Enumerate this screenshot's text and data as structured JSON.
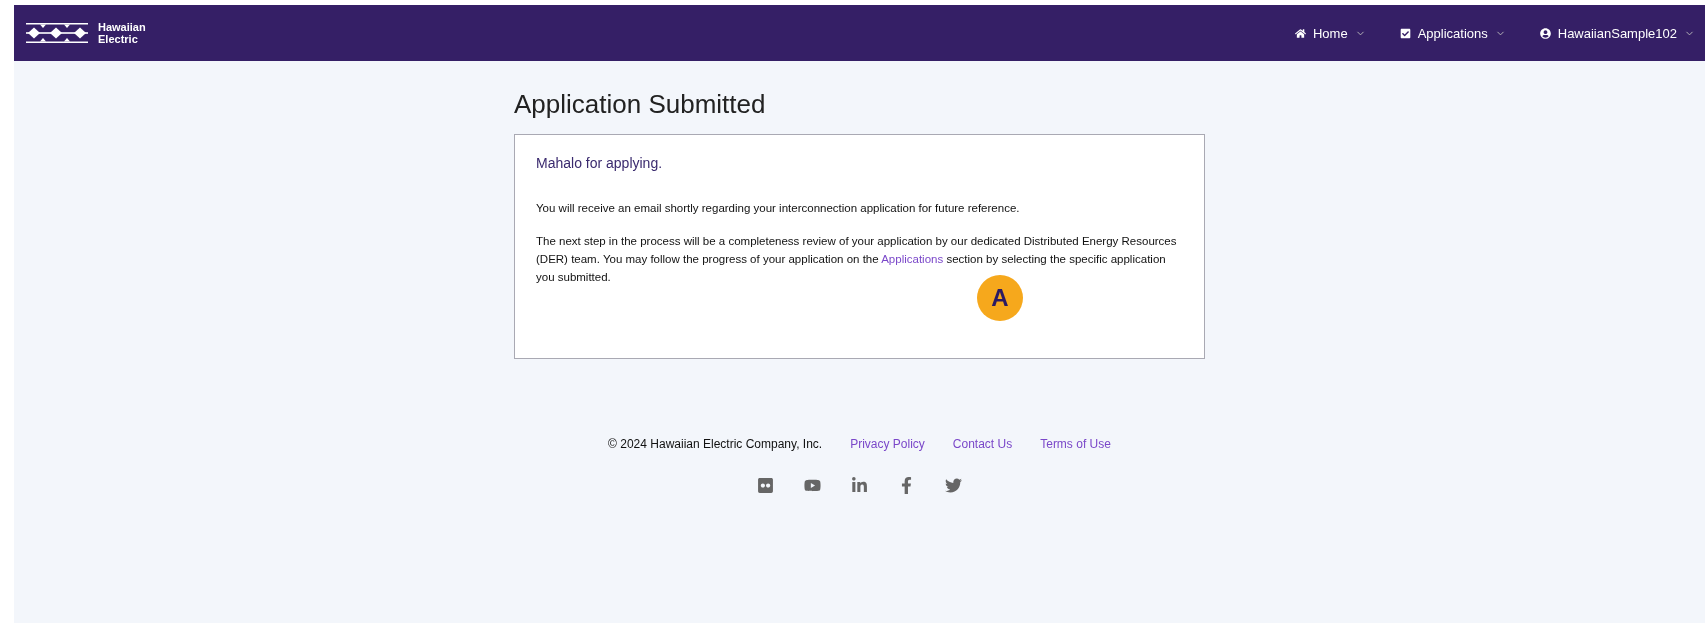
{
  "header": {
    "logo_text": [
      "Hawaiian",
      "Electric"
    ],
    "nav": [
      {
        "kind": "home",
        "label": "Home"
      },
      {
        "kind": "check",
        "label": "Applications"
      },
      {
        "kind": "user",
        "label": "HawaiianSample102"
      }
    ]
  },
  "page": {
    "title": "Application Submitted",
    "card": {
      "heading": "Mahalo for applying.",
      "paragraph_1": "You will receive an email shortly regarding your interconnection application for future reference.",
      "paragraph_2": {
        "before": "The next step in the process will be a completeness review of your application by our dedicated Distributed Energy Resources (DER) team. You may follow the progress of your application on the",
        "link": "Applications",
        "after": "section by selecting the specific application you submitted."
      },
      "callout": "A"
    }
  },
  "footer": {
    "copyright": "© 2024 Hawaiian Electric Company, Inc.",
    "links": [
      "Privacy Policy",
      "Contact Us",
      "Terms of Use"
    ],
    "social": [
      {
        "kind": "flickr"
      },
      {
        "kind": "youtube"
      },
      {
        "kind": "linkedin"
      },
      {
        "kind": "facebook"
      },
      {
        "kind": "twitter"
      }
    ]
  }
}
